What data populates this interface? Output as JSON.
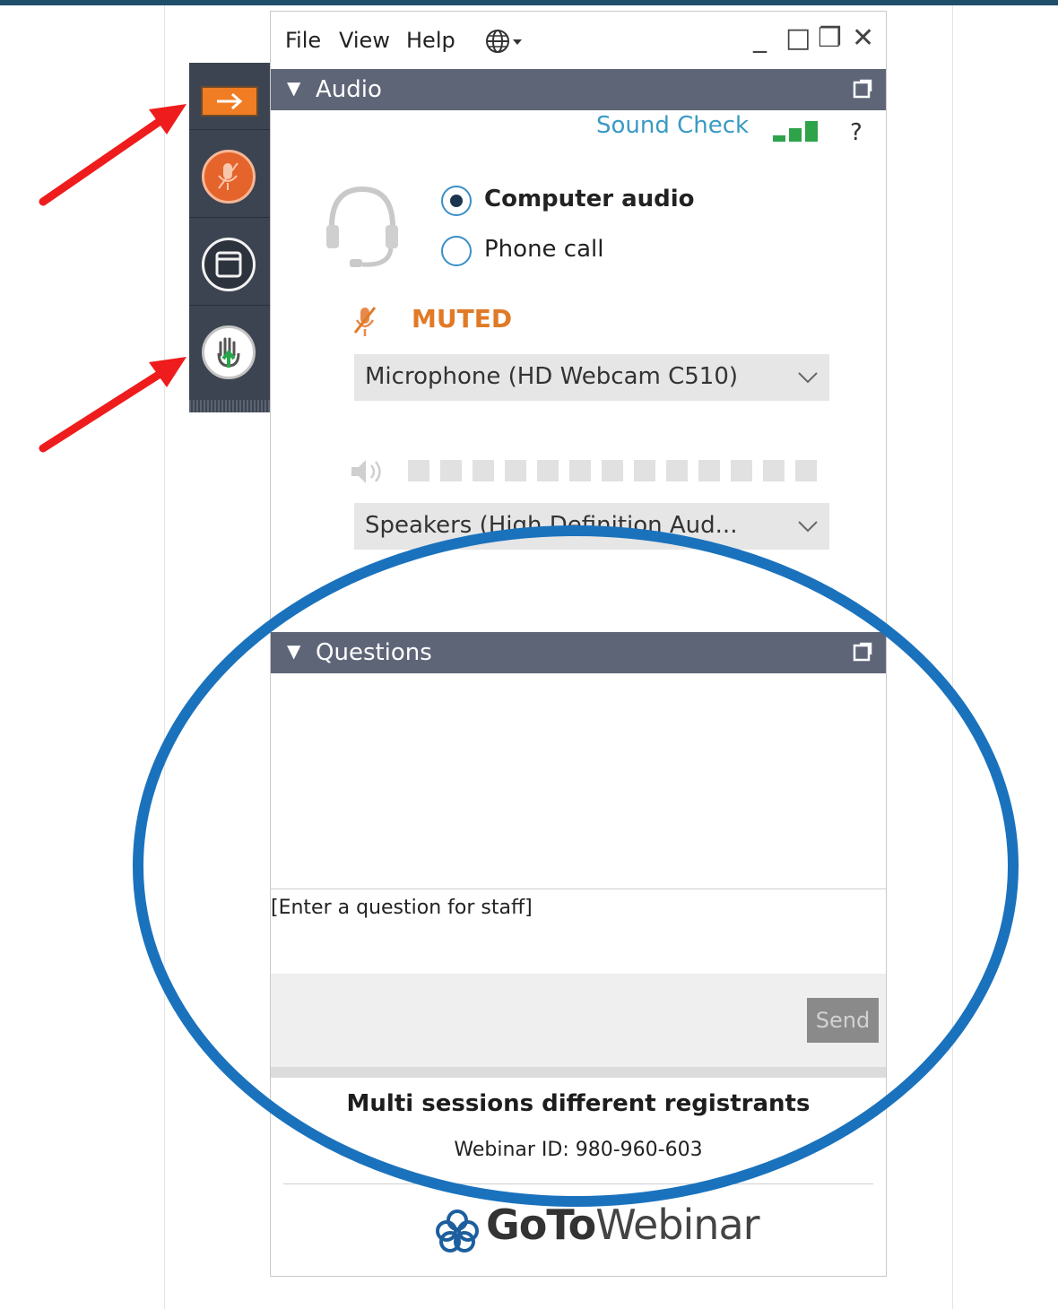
{
  "menu": {
    "file": "File",
    "view": "View",
    "help": "Help",
    "globe_icon": "globe-icon",
    "window_controls": [
      "_",
      "□",
      "❐",
      "✕"
    ]
  },
  "audio": {
    "header": "Audio",
    "sound_check": "Sound Check",
    "help": "?",
    "computer_audio": "Computer audio",
    "phone_call": "Phone call",
    "selected_mode": "Computer audio",
    "muted": "MUTED",
    "microphone": "Microphone (HD Webcam C510)",
    "speakers": "Speakers (High Definition Aud..."
  },
  "questions": {
    "header": "Questions",
    "placeholder": "[Enter a question for staff]",
    "send": "Send"
  },
  "footer": {
    "session_title": "Multi sessions different registrants",
    "webinar_id": "Webinar ID: 980-960-603",
    "brand_bold": "GoTo",
    "brand_light": "Webinar"
  },
  "colors": {
    "header_bg": "#5e6577",
    "toolbar_bg": "#3d4451",
    "accent_orange": "#e07a27",
    "link_blue": "#3a9ac4",
    "highlight_ellipse": "#1a72bd",
    "arrow_red": "#ee1c1c"
  }
}
